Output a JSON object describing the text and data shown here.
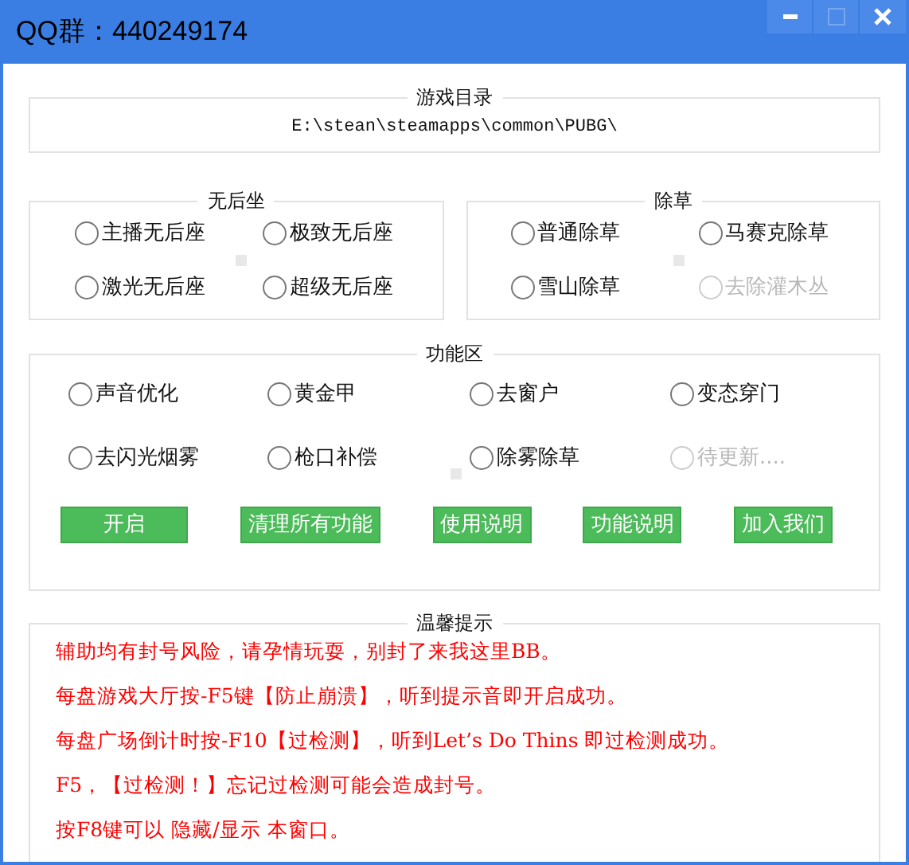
{
  "window": {
    "title": "QQ群：440249174",
    "buttons": [
      {
        "kind": "minimize",
        "disabled": false
      },
      {
        "kind": "maximize",
        "disabled": true
      },
      {
        "kind": "close",
        "disabled": false
      }
    ]
  },
  "game_dir": {
    "title": "游戏目录",
    "path": "E:\\stean\\steamapps\\common\\PUBG\\"
  },
  "no_recoil": {
    "title": "无后坐",
    "options": [
      {
        "label": "主播无后座",
        "checked": false,
        "disabled": false
      },
      {
        "label": "极致无后座",
        "checked": false,
        "disabled": false
      },
      {
        "label": "激光无后座",
        "checked": false,
        "disabled": false
      },
      {
        "label": "超级无后座",
        "checked": false,
        "disabled": false
      }
    ]
  },
  "grass": {
    "title": "除草",
    "options": [
      {
        "label": "普通除草",
        "checked": false,
        "disabled": false
      },
      {
        "label": "马赛克除草",
        "checked": false,
        "disabled": false
      },
      {
        "label": "雪山除草",
        "checked": false,
        "disabled": false
      },
      {
        "label": "去除灌木丛",
        "checked": false,
        "disabled": true
      }
    ]
  },
  "features": {
    "title": "功能区",
    "options": [
      {
        "label": "声音优化",
        "checked": false,
        "disabled": false
      },
      {
        "label": "黄金甲",
        "checked": false,
        "disabled": false
      },
      {
        "label": "去窗户",
        "checked": false,
        "disabled": false
      },
      {
        "label": "变态穿门",
        "checked": false,
        "disabled": false
      },
      {
        "label": "去闪光烟雾",
        "checked": false,
        "disabled": false
      },
      {
        "label": "枪口补偿",
        "checked": false,
        "disabled": false
      },
      {
        "label": "除雾除草",
        "checked": false,
        "disabled": false
      },
      {
        "label": "待更新....",
        "checked": false,
        "disabled": true
      }
    ],
    "buttons": [
      "开启",
      "清理所有功能",
      "使用说明",
      "功能说明",
      "加入我们"
    ]
  },
  "tips": {
    "title": "温馨提示",
    "lines": [
      "辅助均有封号风险，请孕情玩耍，别封了来我这里BB。",
      "每盘游戏大厅按-F5键【防止崩溃】，听到提示音即开启成功。",
      "每盘广场倒计时按-F10【过检测】，听到Let’s Do Thins 即过检测成功。",
      "F5，【过检测！】忘记过检测可能会造成封号。",
      "按F8键可以 隐藏/显示 本窗口。"
    ]
  }
}
